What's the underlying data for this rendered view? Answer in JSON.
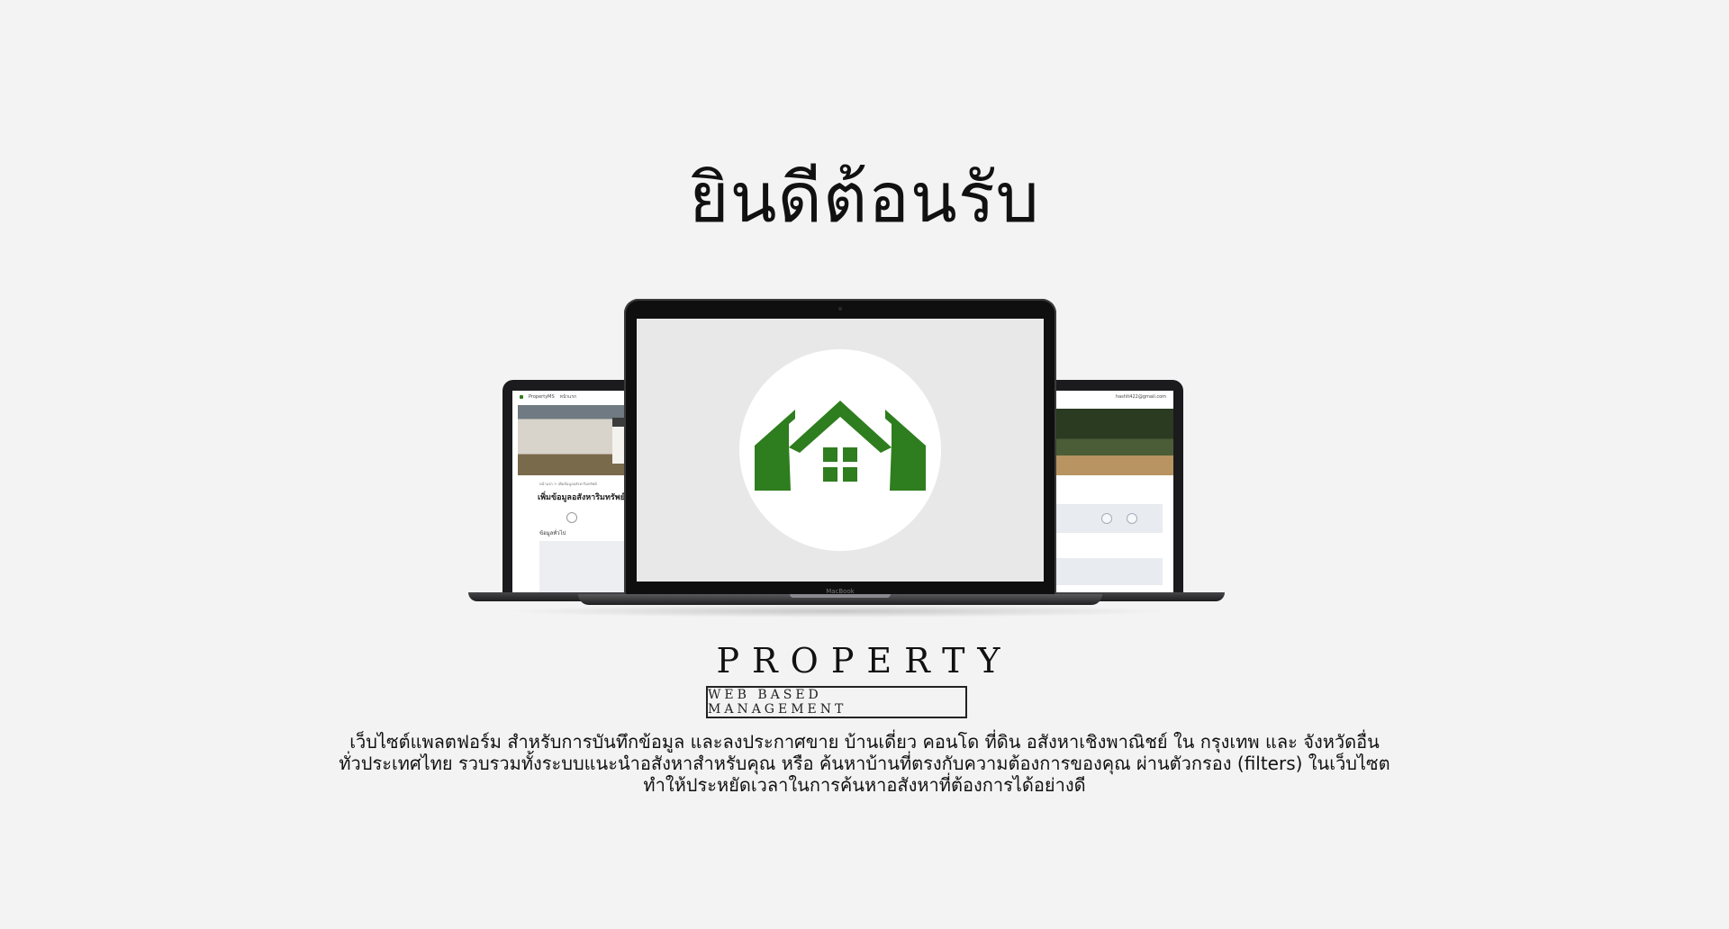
{
  "welcome": {
    "title": "ยินดีต้อนรับ"
  },
  "devices": {
    "center_label": "MacBook",
    "left_screen": {
      "nav_brand": "PropertyMS",
      "nav_link": "หน้าแรก",
      "breadcrumb": "หน้าแรก > เพิ่มข้อมูลอสังหาริมทรัพย์",
      "heading": "เพิ่มข้อมูลอสังหาริมทรัพย์",
      "section_label": "ข้อมูลทั่วไป"
    },
    "right_screen": {
      "nav_email": "hashlt422@gmail.com"
    },
    "logo_icon": "house-logo-icon",
    "logo_color": "#2e7d1e"
  },
  "brand": {
    "name": "PROPERTY",
    "tagline": "WEB BASED MANAGEMENT"
  },
  "description": {
    "line1": "เว็บไซต์แพลตฟอร์ม สำหรับการบันทึกข้อมูล  และลงประกาศขาย บ้านเดี่ยว คอนโด ที่ดิน อสังหาเชิงพาณิชย์ ใน กรุงเทพ และ จังหวัดอื่น",
    "line2": "ทั่วประเทศไทย รวบรวมทั้งระบบแนะนำอสังหาสำหรับคุณ หรือ ค้นหาบ้านที่ตรงกับความต้องการของคุณ ผ่านตัวกรอง (filters) ในเว็บไซต",
    "line3": "ทำให้ประหยัดเวลาในการค้นหาอสังหาที่ต้องการได้อย่างดี"
  }
}
